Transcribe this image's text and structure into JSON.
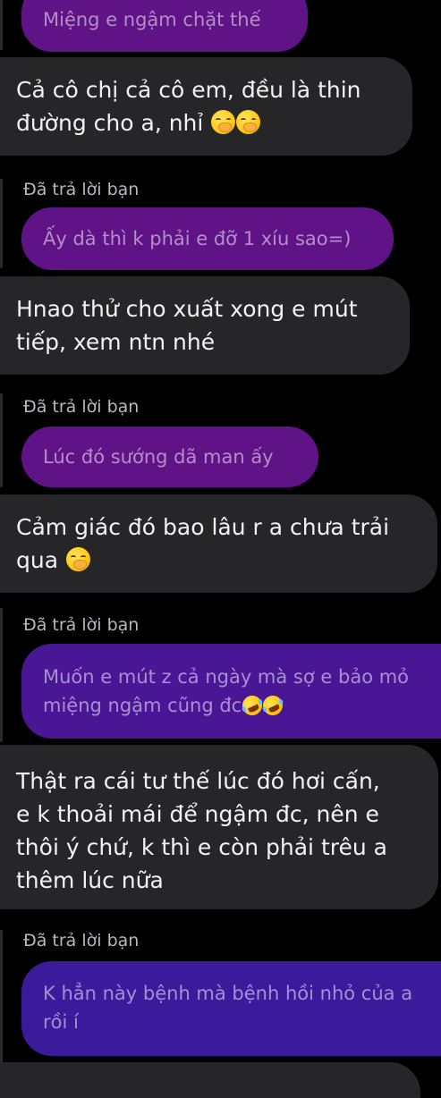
{
  "messages": [
    {
      "id": "m1",
      "type": "outgoing-partial",
      "lines": [
        "Miệng e ngậm chặt thế"
      ]
    },
    {
      "id": "m2",
      "type": "incoming",
      "lines": [
        "Cả cô chị cả cô em, đều là thin",
        "đường cho a, nhỉ"
      ],
      "emoji": [
        "face-with-hand-over-mouth-emoji",
        "face-with-hand-over-mouth-emoji"
      ]
    },
    {
      "id": "r1",
      "reply_label": "Đã trả lời bạn",
      "quoted_lines": [
        "Ấy dà thì k phải e đỡ 1 xíu sao=)"
      ]
    },
    {
      "id": "m3",
      "type": "incoming",
      "lines": [
        "Hnao thử cho xuất xong e mút",
        "tiếp, xem ntn nhé"
      ]
    },
    {
      "id": "r2",
      "reply_label": "Đã trả lời bạn",
      "quoted_lines": [
        "Lúc đó sướng dã man ấy"
      ]
    },
    {
      "id": "m4",
      "type": "incoming",
      "lines": [
        "Cảm giác đó bao lâu r a chưa trải",
        "qua"
      ],
      "emoji": [
        "face-with-hand-over-mouth-emoji"
      ]
    },
    {
      "id": "r3",
      "reply_label": "Đã trả lời bạn",
      "quoted_lines": [
        "Muốn e mút z cả ngày mà sợ e bảo mỏ",
        "miệng ngậm cũng đc"
      ],
      "emoji": [
        "rolling-on-floor-laughing-emoji",
        "rolling-on-floor-laughing-emoji"
      ]
    },
    {
      "id": "m5",
      "type": "incoming",
      "lines": [
        "Thật ra cái tư thế lúc đó hơi cấn,",
        "e k thoải mái để ngậm đc, nên e",
        "thôi ý chứ, k thì e còn phải trêu a",
        "thêm lúc nữa"
      ]
    },
    {
      "id": "r4",
      "reply_label": "Đã trả lời bạn",
      "quoted_lines": [
        "K hẳn này bệnh mà bệnh hồi nhỏ của a",
        "rồi í"
      ]
    }
  ],
  "colors": {
    "background": "#000000",
    "incoming_bubble": "#262628",
    "quoted_purple": "#5f1386",
    "quoted_violet": "#491696",
    "quoted_indigo": "#3b1a9c"
  }
}
